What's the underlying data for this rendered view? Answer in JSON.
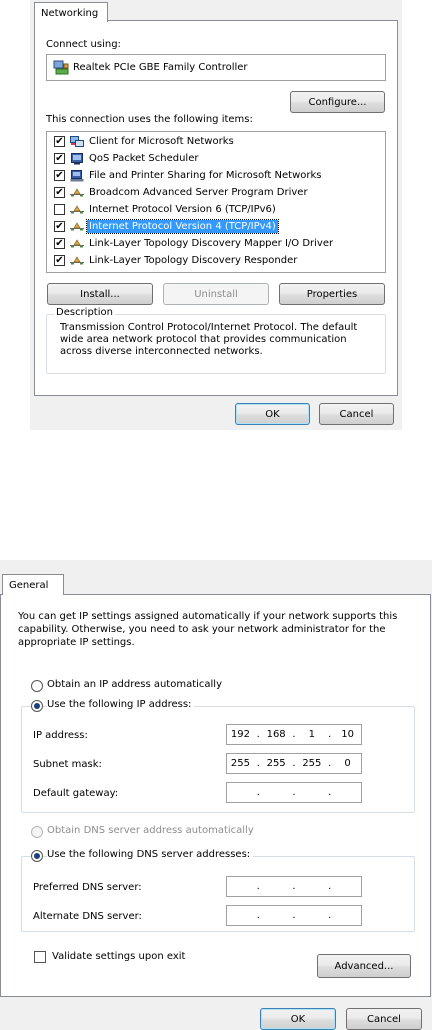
{
  "networking": {
    "tab_label": "Networking",
    "connect_using_label": "Connect using:",
    "adapter_name": "Realtek PCIe GBE Family Controller",
    "configure_button": "Configure...",
    "items_label": "This connection uses the following items:",
    "items": [
      {
        "label": "Client for Microsoft Networks",
        "checked": true,
        "icon": "network-client-icon",
        "selected": false
      },
      {
        "label": "QoS Packet Scheduler",
        "checked": true,
        "icon": "service-icon",
        "selected": false
      },
      {
        "label": "File and Printer Sharing for Microsoft Networks",
        "checked": true,
        "icon": "printer-sharing-icon",
        "selected": false
      },
      {
        "label": "Broadcom Advanced Server Program Driver",
        "checked": true,
        "icon": "protocol-icon",
        "selected": false
      },
      {
        "label": "Internet Protocol Version 6 (TCP/IPv6)",
        "checked": false,
        "icon": "protocol-icon",
        "selected": false
      },
      {
        "label": "Internet Protocol Version 4 (TCP/IPv4)",
        "checked": true,
        "icon": "protocol-icon",
        "selected": true
      },
      {
        "label": "Link-Layer Topology Discovery Mapper I/O Driver",
        "checked": true,
        "icon": "protocol-icon",
        "selected": false
      },
      {
        "label": "Link-Layer Topology Discovery Responder",
        "checked": true,
        "icon": "protocol-icon",
        "selected": false
      }
    ],
    "install_button": "Install...",
    "uninstall_button": "Uninstall",
    "properties_button": "Properties",
    "description_title": "Description",
    "description_text": "Transmission Control Protocol/Internet Protocol. The default wide area network protocol that provides communication across diverse interconnected networks.",
    "ok_button": "OK",
    "cancel_button": "Cancel"
  },
  "general": {
    "tab_label": "General",
    "intro_text": "You can get IP settings assigned automatically if your network supports this capability. Otherwise, you need to ask your network administrator for the appropriate IP settings.",
    "obtain_ip_auto": "Obtain an IP address automatically",
    "use_following_ip": "Use the following IP address:",
    "ip_address_label": "IP address:",
    "ip_address": [
      "192",
      "168",
      "1",
      "10"
    ],
    "subnet_mask_label": "Subnet mask:",
    "subnet_mask": [
      "255",
      "255",
      "255",
      "0"
    ],
    "default_gateway_label": "Default gateway:",
    "default_gateway": [
      "",
      "",
      "",
      ""
    ],
    "obtain_dns_auto": "Obtain DNS server address automatically",
    "use_following_dns": "Use the following DNS server addresses:",
    "preferred_dns_label": "Preferred DNS server:",
    "preferred_dns": [
      "",
      "",
      "",
      ""
    ],
    "alternate_dns_label": "Alternate DNS server:",
    "alternate_dns": [
      "",
      "",
      "",
      ""
    ],
    "validate_label": "Validate settings upon exit",
    "advanced_button": "Advanced...",
    "ok_button": "OK",
    "cancel_button": "Cancel"
  },
  "colors": {
    "selection": "#3399ff",
    "dialog_bg": "#f0f0f0",
    "radio_dot": "#1c3f80"
  }
}
